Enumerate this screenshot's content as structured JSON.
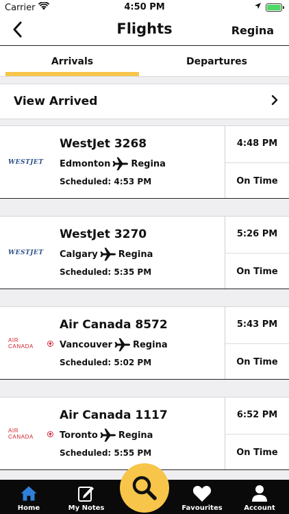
{
  "status_bar": {
    "carrier": "Carrier",
    "time": "4:50 PM"
  },
  "header": {
    "title": "Flights",
    "city": "Regina"
  },
  "tabs": [
    {
      "label": "Arrivals",
      "active": true
    },
    {
      "label": "Departures",
      "active": false
    }
  ],
  "view_arrived": {
    "label": "View Arrived"
  },
  "flights": [
    {
      "name": "WestJet 3268",
      "airline": "westjet",
      "logo_text": "WESTJET",
      "from": "Edmonton",
      "to": "Regina",
      "scheduled": "Scheduled: 4:53 PM",
      "time": "4:48 PM",
      "status": "On Time"
    },
    {
      "name": "WestJet 3270",
      "airline": "westjet",
      "logo_text": "WESTJET",
      "from": "Calgary",
      "to": "Regina",
      "scheduled": "Scheduled: 5:35 PM",
      "time": "5:26 PM",
      "status": "On Time"
    },
    {
      "name": "Air Canada 8572",
      "airline": "aircanada",
      "logo_text": "AIR CANADA",
      "from": "Vancouver",
      "to": "Regina",
      "scheduled": "Scheduled: 5:02 PM",
      "time": "5:43 PM",
      "status": "On Time"
    },
    {
      "name": "Air Canada 1117",
      "airline": "aircanada",
      "logo_text": "AIR CANADA",
      "from": "Toronto",
      "to": "Regina",
      "scheduled": "Scheduled: 5:55 PM",
      "time": "6:52 PM",
      "status": "On Time"
    }
  ],
  "tabbar": {
    "home": "Home",
    "notes": "My Notes",
    "favourites": "Favourites",
    "account": "Account"
  },
  "colors": {
    "accent": "#f6c54a",
    "home_active": "#2f7fd8",
    "westjet": "#2a4f87",
    "aircanada": "#d1202f"
  },
  "icons": [
    "wifi-icon",
    "location-icon",
    "battery-icon",
    "back-chevron-icon",
    "chevron-right-icon",
    "plane-icon",
    "home-icon",
    "notes-icon",
    "search-icon",
    "heart-icon",
    "account-icon"
  ]
}
